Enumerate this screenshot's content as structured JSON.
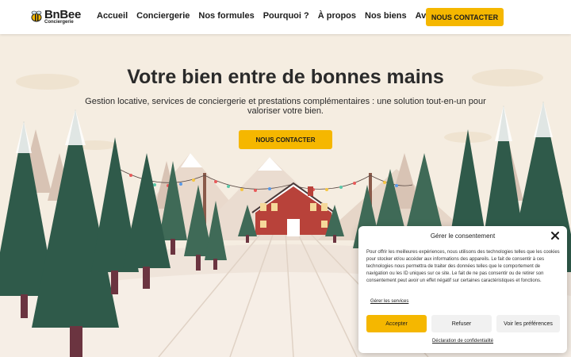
{
  "header": {
    "logo_text": "BnBee",
    "logo_sub": "Conciergerie",
    "nav": [
      "Accueil",
      "Conciergerie",
      "Nos formules",
      "Pourquoi ?",
      "À propos",
      "Nos biens",
      "Avis"
    ],
    "cta_label": "NOUS CONTACTER",
    "accent": "#f5b700"
  },
  "hero": {
    "title": "Votre bien entre de bonnes mains",
    "subtitle": "Gestion locative, services de conciergerie et prestations complémentaires : une solution tout-en-un pour valoriser votre bien.",
    "cta_label": "NOUS CONTACTER",
    "illustration": "winter-forest-red-cabin-illustration"
  },
  "consent": {
    "title": "Gérer le consentement",
    "close_icon": "close-icon",
    "body": "Pour offrir les meilleures expériences, nous utilisons des technologies telles que les cookies pour stocker et/ou accéder aux informations des appareils. Le fait de consentir à ces technologies nous permettra de traiter des données telles que le comportement de navigation ou les ID uniques sur ce site. Le fait de ne pas consentir ou de retirer son consentement peut avoir un effet négatif sur certaines caractéristiques et fonctions.",
    "manage_link": "Gérer les services",
    "accept_label": "Accepter",
    "refuse_label": "Refuser",
    "prefs_label": "Voir les préférences",
    "privacy_link": "Déclaration de confidentialité"
  }
}
